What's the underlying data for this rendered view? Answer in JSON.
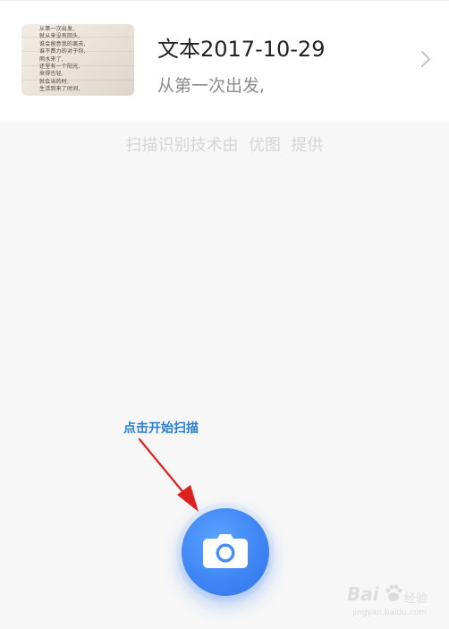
{
  "document": {
    "title": "文本2017-10-29",
    "preview": "从第一次出发,",
    "thumbnail_text": "从第一次出发,\n就从来没有回头,\n谁会留意我的离去,\n谁不费力的对于你,\n雨水来了,\n还里有一个阳光,\n来得也轻,\n就会当的时,\n生活到来了时间,"
  },
  "credit": {
    "text": "扫描识别技术由  优图  提供"
  },
  "annotation": {
    "text": "点击开始扫描"
  },
  "scan_button": {
    "icon": "camera-icon"
  },
  "watermark": {
    "brand": "Bai",
    "word": "经验",
    "url": "jingyan.baidu.com"
  },
  "colors": {
    "accent": "#3f86f5",
    "annotation": "#2a7fd4",
    "arrow": "#e02020",
    "background": "#f7f7f7"
  }
}
